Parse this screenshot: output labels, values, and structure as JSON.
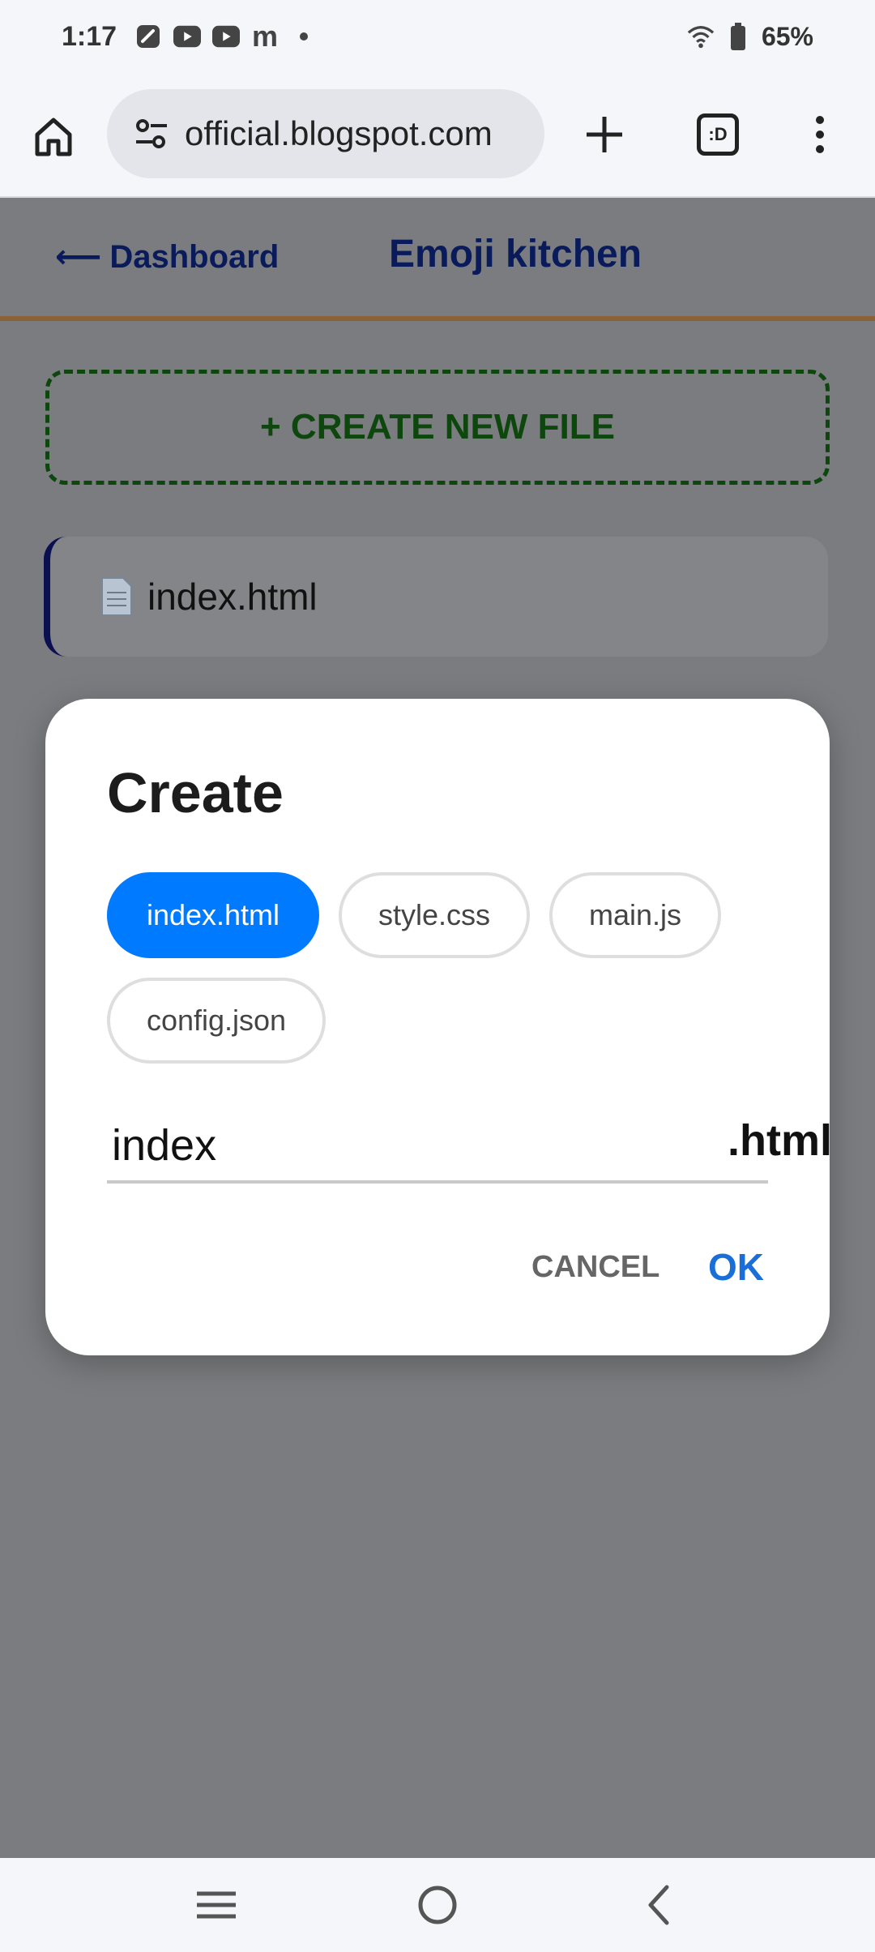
{
  "status": {
    "time": "1:17",
    "battery": "65%",
    "left_icons": [
      "app-icon",
      "youtube-icon",
      "youtube-icon",
      "m-icon",
      "dot-icon"
    ],
    "m_glyph": "m"
  },
  "browser": {
    "url": "official.blogspot.com",
    "tabs_label": ":D"
  },
  "header": {
    "back_label": "Dashboard",
    "back_arrow": "⟵",
    "title": "Emoji kitchen"
  },
  "main": {
    "create_label": "+ CREATE NEW FILE",
    "files": [
      {
        "name": "index.html"
      }
    ]
  },
  "dialog": {
    "title": "Create",
    "chips": [
      {
        "label": "index.html",
        "selected": true
      },
      {
        "label": "style.css",
        "selected": false
      },
      {
        "label": "main.js",
        "selected": false
      },
      {
        "label": "config.json",
        "selected": false
      }
    ],
    "name_value": "index",
    "extension": ".html",
    "cancel_label": "CANCEL",
    "ok_label": "OK"
  },
  "colors": {
    "accent": "#007bff",
    "ok": "#1a6ed8",
    "header_text": "#0a1b5c",
    "create_green": "#0d470d",
    "divider": "#8a6236"
  }
}
